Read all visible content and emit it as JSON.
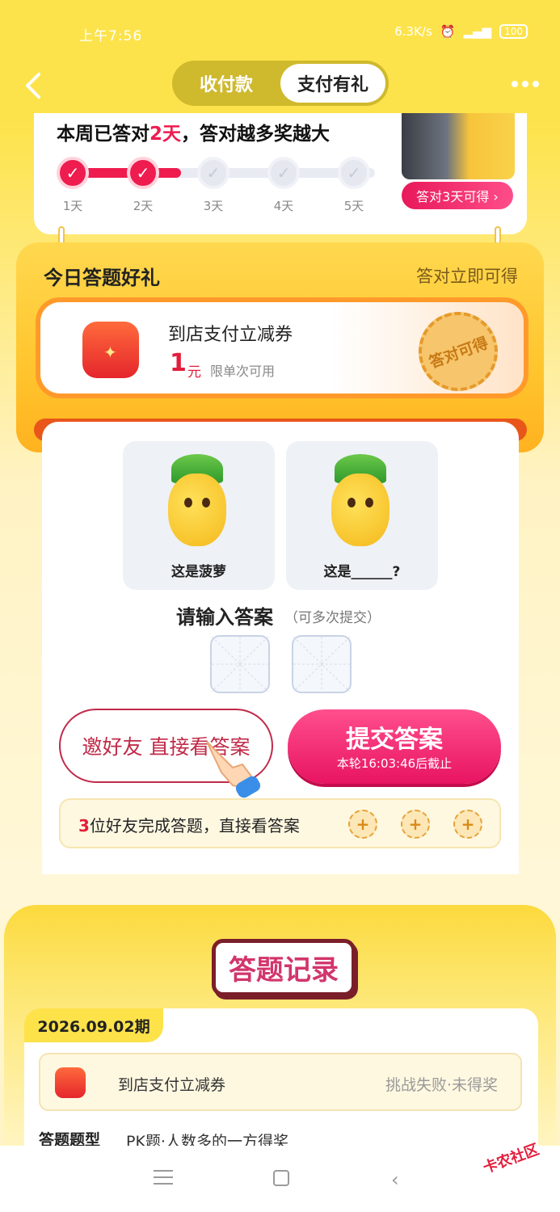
{
  "status": {
    "time": "上午7:56",
    "speed": "6.3K/s",
    "battery": "100"
  },
  "nav": {
    "tab_receive": "收付款",
    "tab_gift": "支付有礼"
  },
  "week": {
    "title_prefix": "本周已答对",
    "title_days": "2天",
    "title_suffix": "，答对越多奖越大",
    "days": [
      "1天",
      "2天",
      "3天",
      "4天",
      "5天"
    ],
    "completed": 2,
    "promo_btn": "答对3天可得 ›"
  },
  "gift": {
    "title": "今日答题好礼",
    "subtitle": "答对立即可得",
    "coupon_name": "到店支付立减券",
    "coupon_value": "1",
    "coupon_unit": "元",
    "coupon_note": "限单次可用",
    "stamp": "答对可得"
  },
  "quiz": {
    "pic1_label": "这是菠萝",
    "pic2_label": "这是______?",
    "answer_title": "请输入答案",
    "answer_sub": "（可多次提交）",
    "invite_btn": "邀好友 直接看答案",
    "submit_main": "提交答案",
    "submit_sub": "本轮16:03:46后截止",
    "friends_num": "3",
    "friends_text": "位好友完成答题，直接看答案",
    "plus": "+"
  },
  "record": {
    "title": "答题记录",
    "period": "2026.09.02期",
    "row_name": "到店支付立减券",
    "row_status": "挑战失败·未得奖",
    "type_label": "答题题型",
    "type_value": "PK题·人数多的一方得奖"
  },
  "watermark": "卡农社区"
}
